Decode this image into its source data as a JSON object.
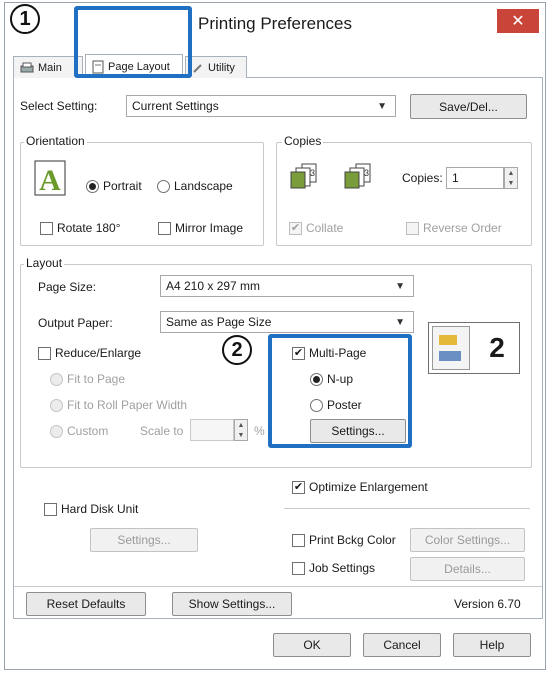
{
  "callouts": {
    "one": "1",
    "two": "2"
  },
  "title": "Printing Preferences",
  "close_glyph": "✕",
  "tabs": [
    {
      "label": "Main",
      "icon": "printer-icon"
    },
    {
      "label": "Page Layout",
      "icon": "page-layout-icon"
    },
    {
      "label": "Utility",
      "icon": "utility-icon"
    }
  ],
  "select_setting": {
    "label": "Select Setting:",
    "value": "Current Settings",
    "save_label": "Save/Del..."
  },
  "orientation": {
    "label": "Orientation",
    "portrait": "Portrait",
    "landscape": "Landscape",
    "rotate": "Rotate 180°",
    "mirror": "Mirror Image",
    "selected": "Portrait"
  },
  "copies": {
    "label": "Copies",
    "copies_label": "Copies:",
    "copies_value": "1",
    "collate": "Collate",
    "reverse": "Reverse Order"
  },
  "layout": {
    "label": "Layout",
    "page_size_label": "Page Size:",
    "page_size_value": "A4 210 x 297 mm",
    "output_paper_label": "Output Paper:",
    "output_paper_value": "Same as Page Size",
    "reduce_enlarge": "Reduce/Enlarge",
    "fit_page": "Fit to Page",
    "fit_roll": "Fit to Roll Paper Width",
    "custom": "Custom",
    "scale_to": "Scale to",
    "percent": "%",
    "multi_page": "Multi-Page",
    "nup": "N-up",
    "poster": "Poster",
    "settings": "Settings...",
    "preview_number": "2"
  },
  "optimize_enlargement": "Optimize Enlargement",
  "hard_disk_unit": "Hard Disk Unit",
  "hd_settings": "Settings...",
  "print_bckg_color": "Print Bckg Color",
  "color_settings": "Color Settings...",
  "job_settings": "Job Settings",
  "details": "Details...",
  "reset_defaults": "Reset Defaults",
  "show_settings": "Show Settings...",
  "version": "Version 6.70",
  "ok": "OK",
  "cancel": "Cancel",
  "help": "Help",
  "colors": {
    "highlight": "#1f70c2",
    "close": "#c9453a"
  }
}
